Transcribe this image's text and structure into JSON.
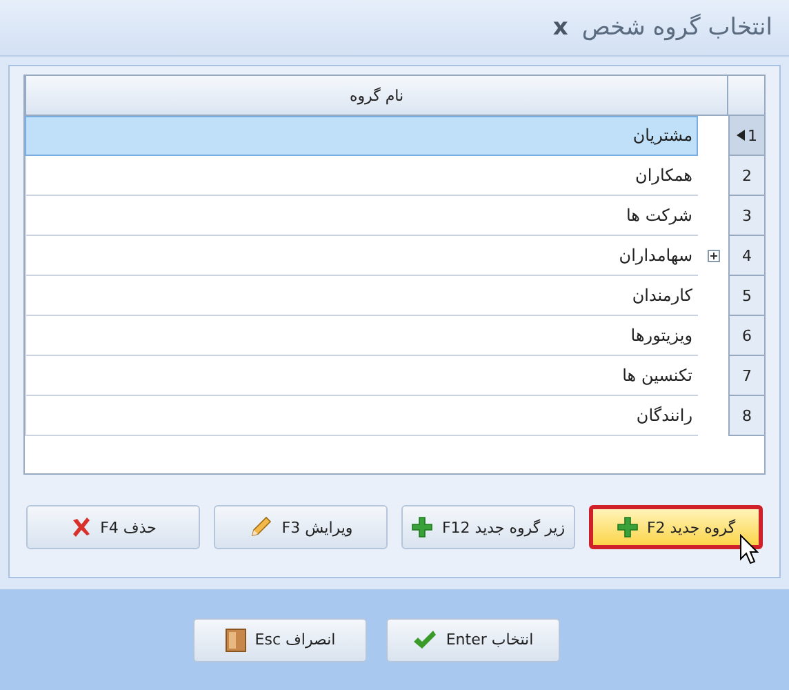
{
  "window": {
    "title": "انتخاب گروه شخص",
    "close": "x"
  },
  "grid": {
    "column": "نام گروه",
    "rows": [
      {
        "number": "1",
        "name": "مشتریان",
        "selected": true,
        "expandable": false
      },
      {
        "number": "2",
        "name": "همکاران",
        "selected": false,
        "expandable": false
      },
      {
        "number": "3",
        "name": "شرکت ها",
        "selected": false,
        "expandable": false
      },
      {
        "number": "4",
        "name": "سهامداران",
        "selected": false,
        "expandable": true
      },
      {
        "number": "5",
        "name": "کارمندان",
        "selected": false,
        "expandable": false
      },
      {
        "number": "6",
        "name": "ویزیتورها",
        "selected": false,
        "expandable": false
      },
      {
        "number": "7",
        "name": "تکنسین ها",
        "selected": false,
        "expandable": false
      },
      {
        "number": "8",
        "name": "رانندگان",
        "selected": false,
        "expandable": false
      }
    ]
  },
  "actions": [
    {
      "label": "گروه جدید F2",
      "kind": "add",
      "selected": true
    },
    {
      "label": "زیر گروه جدید F12",
      "kind": "add",
      "selected": false
    },
    {
      "label": "ویرایش F3",
      "kind": "edit",
      "selected": false
    },
    {
      "label": "حذف F4",
      "kind": "delete",
      "selected": false
    }
  ],
  "footer": [
    {
      "label": "انتخاب Enter",
      "kind": "ok"
    },
    {
      "label": "انصراف Esc",
      "kind": "exit"
    }
  ]
}
